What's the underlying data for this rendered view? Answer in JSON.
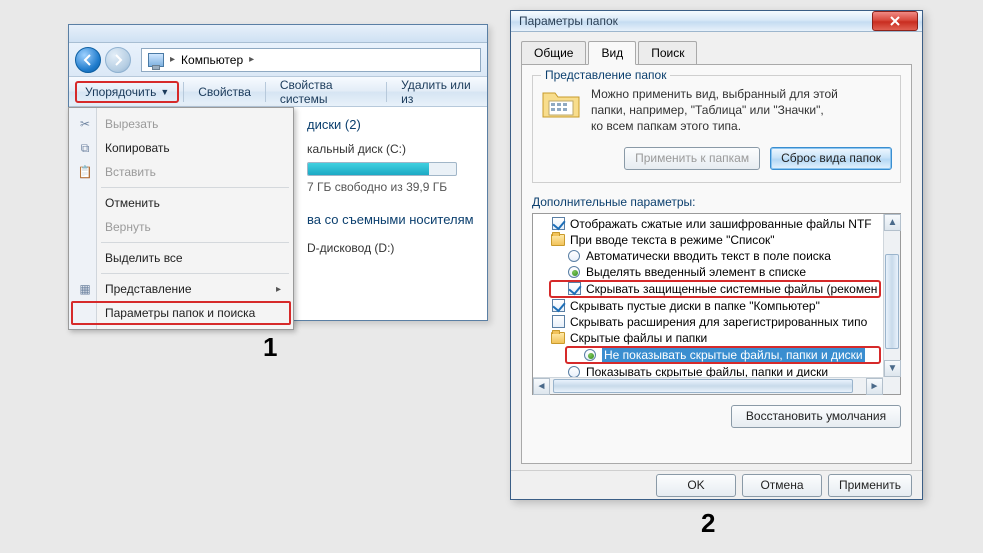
{
  "step_labels": {
    "one": "1",
    "two": "2"
  },
  "explorer": {
    "breadcrumb": {
      "root": "Компьютер"
    },
    "toolbar": {
      "organize": "Упорядочить",
      "properties": "Свойства",
      "system_properties": "Свойства системы",
      "remove_or": "Удалить или из"
    },
    "group_heading": "диски (2)",
    "drive_c": {
      "name": "кальный диск (C:)",
      "free_text": "7 ГБ свободно из 39,9 ГБ"
    },
    "removable_heading": "ва со съемными носителям",
    "dvd_name": "D-дисковод (D:)",
    "menu": {
      "cut": "Вырезать",
      "copy": "Копировать",
      "paste": "Вставить",
      "undo": "Отменить",
      "redo": "Вернуть",
      "select_all": "Выделить все",
      "layout": "Представление",
      "folder_options": "Параметры папок и поиска"
    }
  },
  "dialog": {
    "title": "Параметры папок",
    "tabs": {
      "general": "Общие",
      "view": "Вид",
      "search": "Поиск"
    },
    "folder_views": {
      "legend": "Представление папок",
      "text1": "Можно применить вид, выбранный для этой",
      "text2": "папки, например, \"Таблица\" или \"Значки\",",
      "text3": "ко всем папкам этого типа.",
      "apply_btn": "Применить к папкам",
      "reset_btn": "Сброс вида папок"
    },
    "advanced_label": "Дополнительные параметры:",
    "advanced": {
      "show_compressed": "Отображать сжатые или зашифрованные файлы NTF",
      "list_typing_group": "При вводе текста в режиме \"Список\"",
      "auto_type_search": "Автоматически вводить текст в поле поиска",
      "select_typed_item": "Выделять введенный элемент в списке",
      "hide_protected": "Скрывать защищенные системные файлы (рекомен",
      "hide_empty_drives": "Скрывать пустые диски в папке \"Компьютер\"",
      "hide_extensions": "Скрывать расширения для зарегистрированных типо",
      "hidden_group": "Скрытые файлы и папки",
      "dont_show_hidden": "Не показывать скрытые файлы, папки и диски",
      "show_hidden": "Показывать скрытые файлы, папки и диски"
    },
    "restore_defaults": "Восстановить умолчания",
    "footer": {
      "ok": "OK",
      "cancel": "Отмена",
      "apply": "Применить"
    }
  }
}
